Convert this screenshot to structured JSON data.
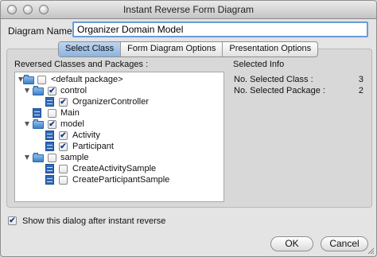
{
  "window": {
    "title": "Instant Reverse Form Diagram",
    "controls": [
      "close-button",
      "minimize-button",
      "zoom-button"
    ]
  },
  "diagram_name": {
    "label": "Diagram Name :",
    "value": "Organizer Domain Model"
  },
  "tabs": [
    {
      "label": "Select Class",
      "selected": true
    },
    {
      "label": "Form Diagram Options",
      "selected": false
    },
    {
      "label": "Presentation Options",
      "selected": false
    }
  ],
  "tree": {
    "heading": "Reversed Classes and Packages :",
    "rows": [
      {
        "label": "<default package>",
        "type": "package",
        "expanded": true,
        "checked": false
      },
      {
        "label": "control",
        "type": "package",
        "expanded": true,
        "checked": true
      },
      {
        "label": "OrganizerController",
        "type": "class",
        "checked": true
      },
      {
        "label": "Main",
        "type": "class",
        "checked": false
      },
      {
        "label": "model",
        "type": "package",
        "expanded": true,
        "checked": true
      },
      {
        "label": "Activity",
        "type": "class",
        "checked": true
      },
      {
        "label": "Participant",
        "type": "class",
        "checked": true
      },
      {
        "label": "sample",
        "type": "package",
        "expanded": true,
        "checked": false
      },
      {
        "label": "CreateActivitySample",
        "type": "class",
        "checked": false
      },
      {
        "label": "CreateParticipantSample",
        "type": "class",
        "checked": false
      }
    ]
  },
  "selected_info": {
    "heading": "Selected Info",
    "class_label": "No. Selected Class :",
    "class_value": "3",
    "package_label": "No. Selected Package :",
    "package_value": "2"
  },
  "footer": {
    "show_dialog_label": "Show this dialog after instant reverse",
    "show_dialog_checked": true,
    "ok_label": "OK",
    "cancel_label": "Cancel"
  }
}
